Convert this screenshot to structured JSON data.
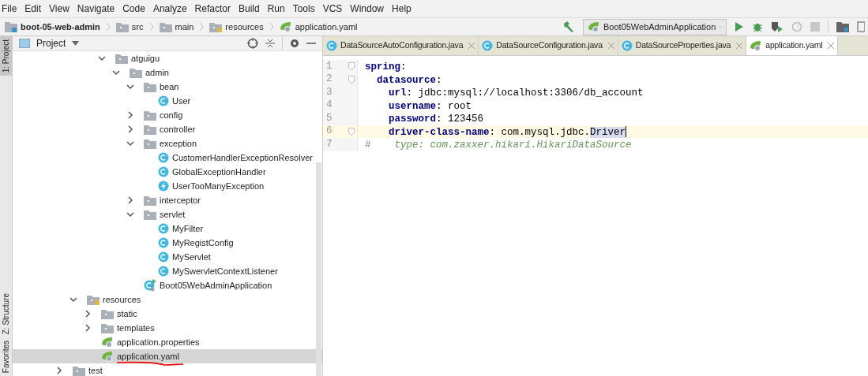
{
  "menu": [
    "File",
    "Edit",
    "View",
    "Navigate",
    "Code",
    "Analyze",
    "Refactor",
    "Build",
    "Run",
    "Tools",
    "VCS",
    "Window",
    "Help"
  ],
  "breadcrumbs": [
    {
      "label": "boot-05-web-admin",
      "kind": "module"
    },
    {
      "label": "src",
      "kind": "folder"
    },
    {
      "label": "main",
      "kind": "folder"
    },
    {
      "label": "resources",
      "kind": "resources"
    },
    {
      "label": "application.yaml",
      "kind": "yaml"
    }
  ],
  "run_config": "Boot05WebAdminApplication",
  "side_tabs": [
    {
      "label": "1: Project",
      "selected": true
    },
    {
      "label": "Z: Structure",
      "selected": false
    },
    {
      "label": "Favorites",
      "selected": false
    }
  ],
  "project_panel": {
    "title": "Project"
  },
  "tree": [
    {
      "label": "atguigu",
      "kind": "folder",
      "expanded": true,
      "selected": false,
      "children": [
        {
          "label": "admin",
          "kind": "folder",
          "expanded": true,
          "selected": false,
          "children": [
            {
              "label": "bean",
              "kind": "folder",
              "expanded": true,
              "selected": false,
              "children": [
                {
                  "label": "User",
                  "kind": "class",
                  "selected": false
                }
              ]
            },
            {
              "label": "config",
              "kind": "folder",
              "expanded": false,
              "selected": false
            },
            {
              "label": "controller",
              "kind": "folder",
              "expanded": false,
              "selected": false
            },
            {
              "label": "exception",
              "kind": "folder",
              "expanded": true,
              "selected": false,
              "children": [
                {
                  "label": "CustomerHandlerExceptionResolver",
                  "kind": "class",
                  "selected": false
                },
                {
                  "label": "GlobalExceptionHandler",
                  "kind": "class",
                  "selected": false
                },
                {
                  "label": "UserTooManyException",
                  "kind": "exception",
                  "selected": false
                }
              ]
            },
            {
              "label": "interceptor",
              "kind": "folder",
              "expanded": false,
              "selected": false
            },
            {
              "label": "servlet",
              "kind": "folder",
              "expanded": true,
              "selected": false,
              "children": [
                {
                  "label": "MyFilter",
                  "kind": "class",
                  "selected": false
                },
                {
                  "label": "MyRegistConfig",
                  "kind": "class",
                  "selected": false
                },
                {
                  "label": "MyServlet",
                  "kind": "class",
                  "selected": false
                },
                {
                  "label": "MySwervletContextListener",
                  "kind": "class",
                  "selected": false
                }
              ]
            },
            {
              "label": "Boot05WebAdminApplication",
              "kind": "spring-class",
              "selected": false
            }
          ]
        }
      ]
    },
    {
      "label": "resources",
      "kind": "resources",
      "expanded": true,
      "selected": false,
      "children": [
        {
          "label": "static",
          "kind": "folder",
          "expanded": false,
          "selected": false
        },
        {
          "label": "templates",
          "kind": "folder",
          "expanded": false,
          "selected": false
        },
        {
          "label": "application.properties",
          "kind": "yaml",
          "selected": false
        },
        {
          "label": "application.yaml",
          "kind": "yaml",
          "selected": true,
          "underlined": true
        }
      ]
    },
    {
      "label": "test",
      "kind": "folder",
      "expanded": false,
      "selected": false
    }
  ],
  "tabs": [
    {
      "label": "DataSourceAutoConfiguration.java",
      "kind": "class",
      "selected": false
    },
    {
      "label": "DataSourceConfiguration.java",
      "kind": "class",
      "selected": false
    },
    {
      "label": "DataSourceProperties.java",
      "kind": "class",
      "selected": false
    },
    {
      "label": "application.yaml",
      "kind": "yaml",
      "selected": true
    }
  ],
  "editor_lines": [
    {
      "number": "1",
      "current": false,
      "fold": true,
      "tokens": [
        {
          "kind": "key",
          "text": "spring"
        },
        {
          "kind": "punct",
          "text": ":"
        }
      ]
    },
    {
      "number": "2",
      "current": false,
      "fold": true,
      "tokens": [
        {
          "kind": "key",
          "text": "  datasource"
        },
        {
          "kind": "punct",
          "text": ":"
        }
      ]
    },
    {
      "number": "3",
      "current": false,
      "fold": false,
      "tokens": [
        {
          "kind": "key",
          "text": "    url"
        },
        {
          "kind": "punct",
          "text": ": "
        },
        {
          "kind": "value",
          "text": "jdbc:mysql://localhost:3306/db_account"
        }
      ]
    },
    {
      "number": "4",
      "current": false,
      "fold": false,
      "tokens": [
        {
          "kind": "key",
          "text": "    username"
        },
        {
          "kind": "punct",
          "text": ": "
        },
        {
          "kind": "value",
          "text": "root"
        }
      ]
    },
    {
      "number": "5",
      "current": false,
      "fold": false,
      "tokens": [
        {
          "kind": "key",
          "text": "    password"
        },
        {
          "kind": "punct",
          "text": ": "
        },
        {
          "kind": "value",
          "text": "123456"
        }
      ]
    },
    {
      "number": "6",
      "current": true,
      "fold": true,
      "tokens": [
        {
          "kind": "key",
          "text": "    driver-class-name"
        },
        {
          "kind": "punct",
          "text": ": "
        },
        {
          "kind": "value",
          "text": "com.mysql.jdbc."
        },
        {
          "kind": "selected",
          "text": "Driver"
        }
      ]
    },
    {
      "number": "7",
      "current": false,
      "fold": false,
      "tokens": [
        {
          "kind": "comment-mark",
          "text": "#"
        },
        {
          "kind": "comment",
          "text": "    type: com.zaxxer.hikari.HikariDataSource"
        }
      ]
    }
  ]
}
